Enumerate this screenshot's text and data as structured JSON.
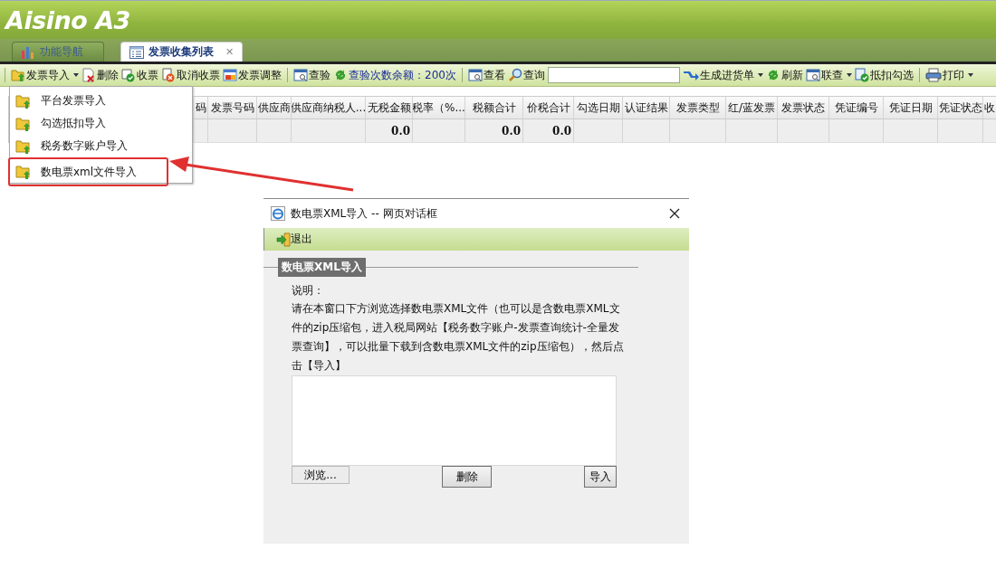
{
  "header": {
    "logo": "Aisino A3"
  },
  "tabs": [
    {
      "label": "功能导航",
      "selected": false
    },
    {
      "label": "发票收集列表",
      "selected": true,
      "close": "✕"
    }
  ],
  "toolbar": [
    [
      {
        "kind": "button",
        "label": "发票导入",
        "dropdown": true
      },
      {
        "kind": "button",
        "label": "删除",
        "dropdown": false
      },
      {
        "kind": "button",
        "label": "收票",
        "dropdown": false
      },
      {
        "kind": "button",
        "label": "取消收票",
        "dropdown": false
      },
      {
        "kind": "button",
        "label": "发票调整",
        "dropdown": false
      }
    ],
    [
      {
        "kind": "button",
        "label": "查验",
        "dropdown": false
      },
      {
        "kind": "info",
        "label": "查验次数余额：200次",
        "dropdown": false
      }
    ],
    [
      {
        "kind": "button",
        "label": "查看",
        "dropdown": false
      },
      {
        "kind": "button",
        "label": "查询",
        "dropdown": false
      },
      {
        "kind": "field"
      },
      {
        "kind": "button",
        "label": "生成进货单",
        "dropdown": true
      },
      {
        "kind": "button",
        "label": "刷新",
        "dropdown": false
      },
      {
        "kind": "button",
        "label": "联查",
        "dropdown": true
      },
      {
        "kind": "button",
        "label": "抵扣勾选",
        "dropdown": false
      }
    ],
    [
      {
        "kind": "button",
        "label": "打印",
        "dropdown": true
      }
    ]
  ],
  "table": {
    "columns": [
      "码",
      "发票号码",
      "供应商",
      "供应商纳税人...",
      "无税金额",
      "税率（%...",
      "税额合计",
      "价税合计",
      "勾选日期",
      "认证结果",
      "发票类型",
      "红/蓝发票",
      "发票状态",
      "凭证编号",
      "凭证日期",
      "凭证状态",
      "收"
    ],
    "rows": [
      [
        "",
        "",
        "",
        "",
        "0.0",
        "",
        "0.0",
        "0.0",
        "",
        "",
        "",
        "",
        "",
        "",
        "",
        ""
      ]
    ]
  },
  "import_menu": [
    {
      "label": "平台发票导入",
      "highlighted": false
    },
    {
      "label": "勾选抵扣导入",
      "highlighted": false
    },
    {
      "label": "税务数字账户导入",
      "highlighted": false
    },
    {
      "label": "数电票xml文件导入",
      "highlighted": true
    }
  ],
  "dialog": {
    "title": "数电票XML导入 -- 网页对话框",
    "toolbar": [
      "退出"
    ],
    "legend": "数电票XML导入",
    "note_label": "说明：",
    "note": "请在本窗口下方浏览选择数电票XML文件（也可以是含数电票XML文件的zip压缩包，进入税局网站【税务数字账户-发票查询统计-全量发票查询】，可以批量下载到含数电票XML文件的zip压缩包），然后点击【导入】",
    "buttons": [
      {
        "label": "浏览...",
        "kind": "flat"
      },
      {
        "label": "删除",
        "kind": "raised"
      },
      {
        "label": "导入",
        "kind": "raised"
      }
    ]
  }
}
